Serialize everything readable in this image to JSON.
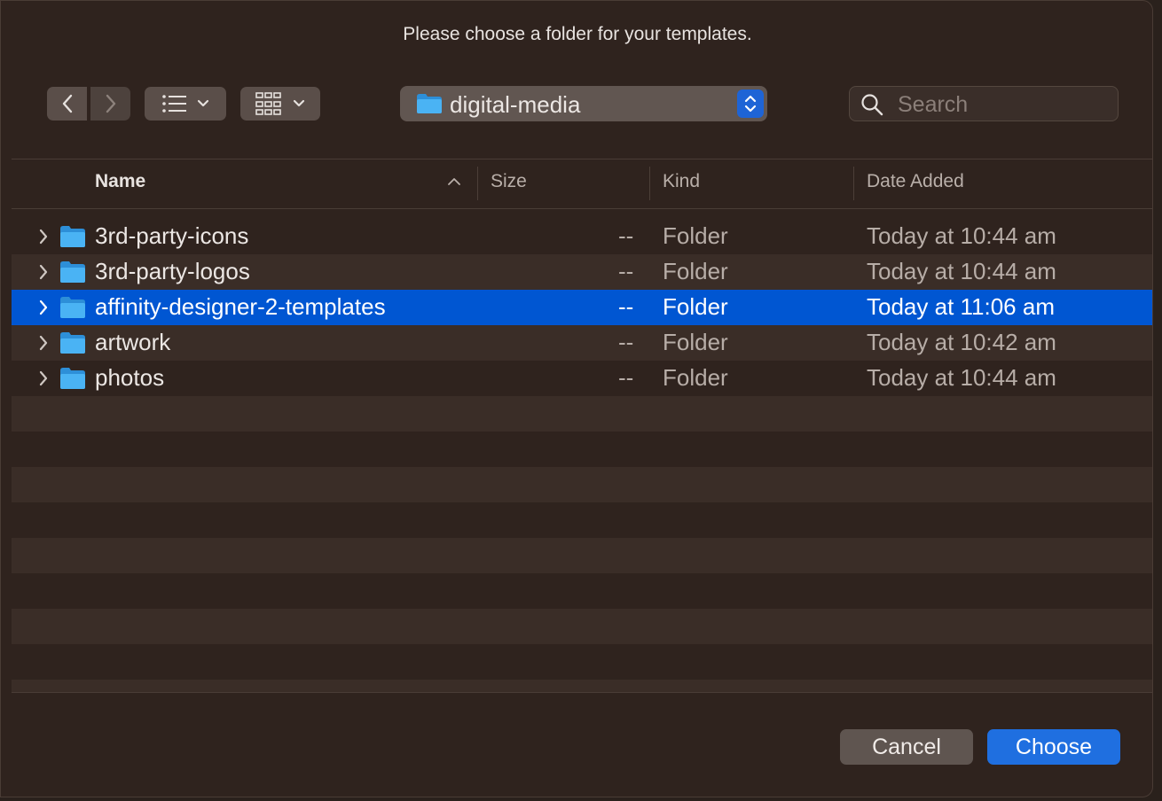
{
  "dialog": {
    "prompt": "Please choose a folder for your templates."
  },
  "toolbar": {
    "back_icon": "chevron-left-icon",
    "forward_icon": "chevron-right-icon",
    "list_view_icon": "list-view-icon",
    "grid_view_icon": "icon-grid-view-icon",
    "path_popup_value": "digital-media",
    "search_placeholder": "Search"
  },
  "columns": {
    "name": "Name",
    "size": "Size",
    "kind": "Kind",
    "date_added": "Date Added"
  },
  "rows": [
    {
      "name": "3rd-party-icons",
      "size": "--",
      "kind": "Folder",
      "date": "Today at 10:44 am"
    },
    {
      "name": "3rd-party-logos",
      "size": "--",
      "kind": "Folder",
      "date": "Today at 10:44 am"
    },
    {
      "name": "affinity-designer-2-templates",
      "size": "--",
      "kind": "Folder",
      "date": "Today at 11:06 am"
    },
    {
      "name": "artwork",
      "size": "--",
      "kind": "Folder",
      "date": "Today at 10:42 am"
    },
    {
      "name": "photos",
      "size": "--",
      "kind": "Folder",
      "date": "Today at 10:44 am"
    }
  ],
  "selected_row": "affinity-designer-2-templates",
  "buttons": {
    "cancel": "Cancel",
    "choose": "Choose"
  },
  "colors": {
    "accent": "#1f6fe0",
    "selection": "#0056d2",
    "folder": "#3fa9f5"
  }
}
